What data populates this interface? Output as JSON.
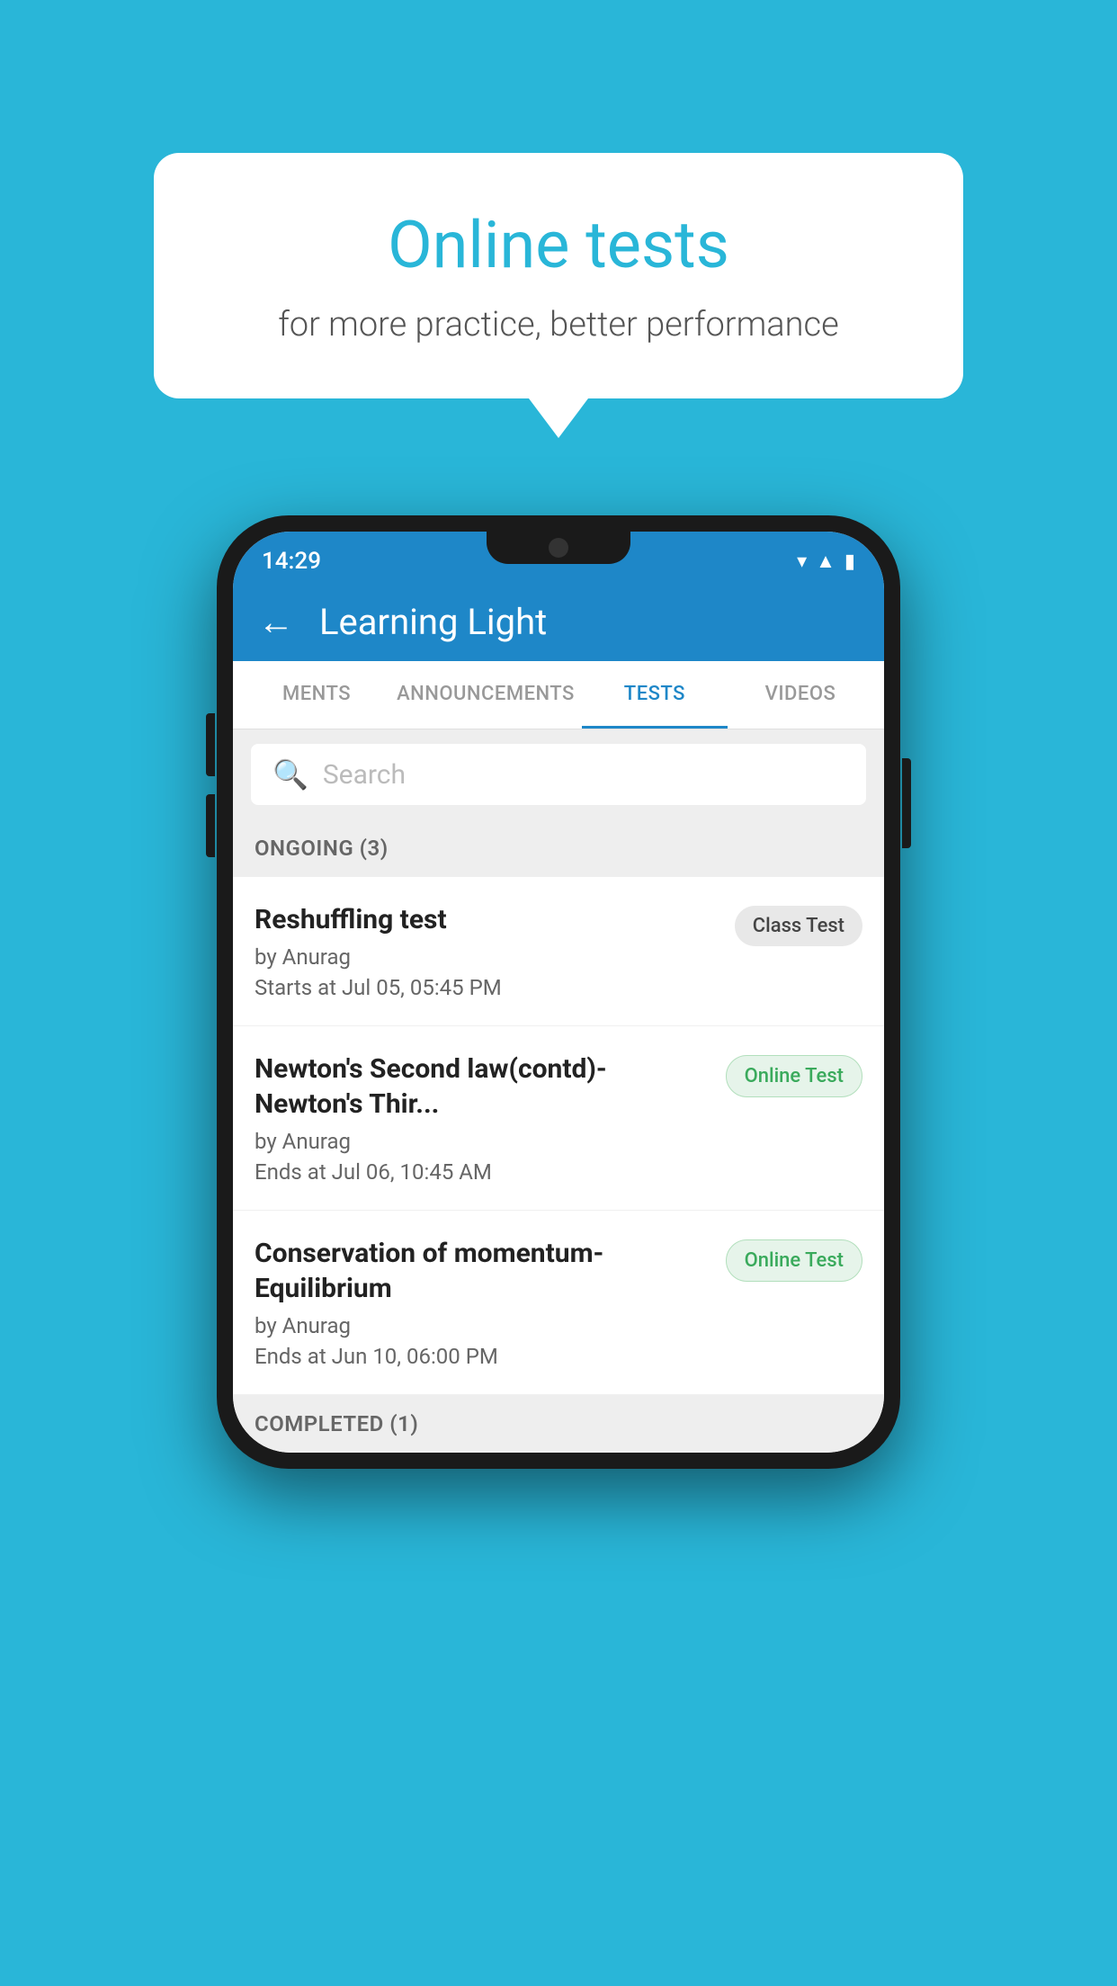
{
  "background_color": "#29b6d8",
  "promo": {
    "title": "Online tests",
    "subtitle": "for more practice, better performance"
  },
  "status_bar": {
    "time": "14:29",
    "icons": [
      "wifi",
      "signal",
      "battery"
    ]
  },
  "app_bar": {
    "title": "Learning Light",
    "back_label": "←"
  },
  "tabs": [
    {
      "label": "MENTS",
      "active": false
    },
    {
      "label": "ANNOUNCEMENTS",
      "active": false
    },
    {
      "label": "TESTS",
      "active": true
    },
    {
      "label": "VIDEOS",
      "active": false
    }
  ],
  "search": {
    "placeholder": "Search"
  },
  "ongoing_section": {
    "label": "ONGOING (3)"
  },
  "tests": [
    {
      "name": "Reshuffling test",
      "author": "by Anurag",
      "time_label": "Starts at",
      "time": "Jul 05, 05:45 PM",
      "badge": "Class Test",
      "badge_type": "class"
    },
    {
      "name": "Newton's Second law(contd)-Newton's Thir...",
      "author": "by Anurag",
      "time_label": "Ends at",
      "time": "Jul 06, 10:45 AM",
      "badge": "Online Test",
      "badge_type": "online"
    },
    {
      "name": "Conservation of momentum-Equilibrium",
      "author": "by Anurag",
      "time_label": "Ends at",
      "time": "Jun 10, 06:00 PM",
      "badge": "Online Test",
      "badge_type": "online"
    }
  ],
  "completed_section": {
    "label": "COMPLETED (1)"
  }
}
